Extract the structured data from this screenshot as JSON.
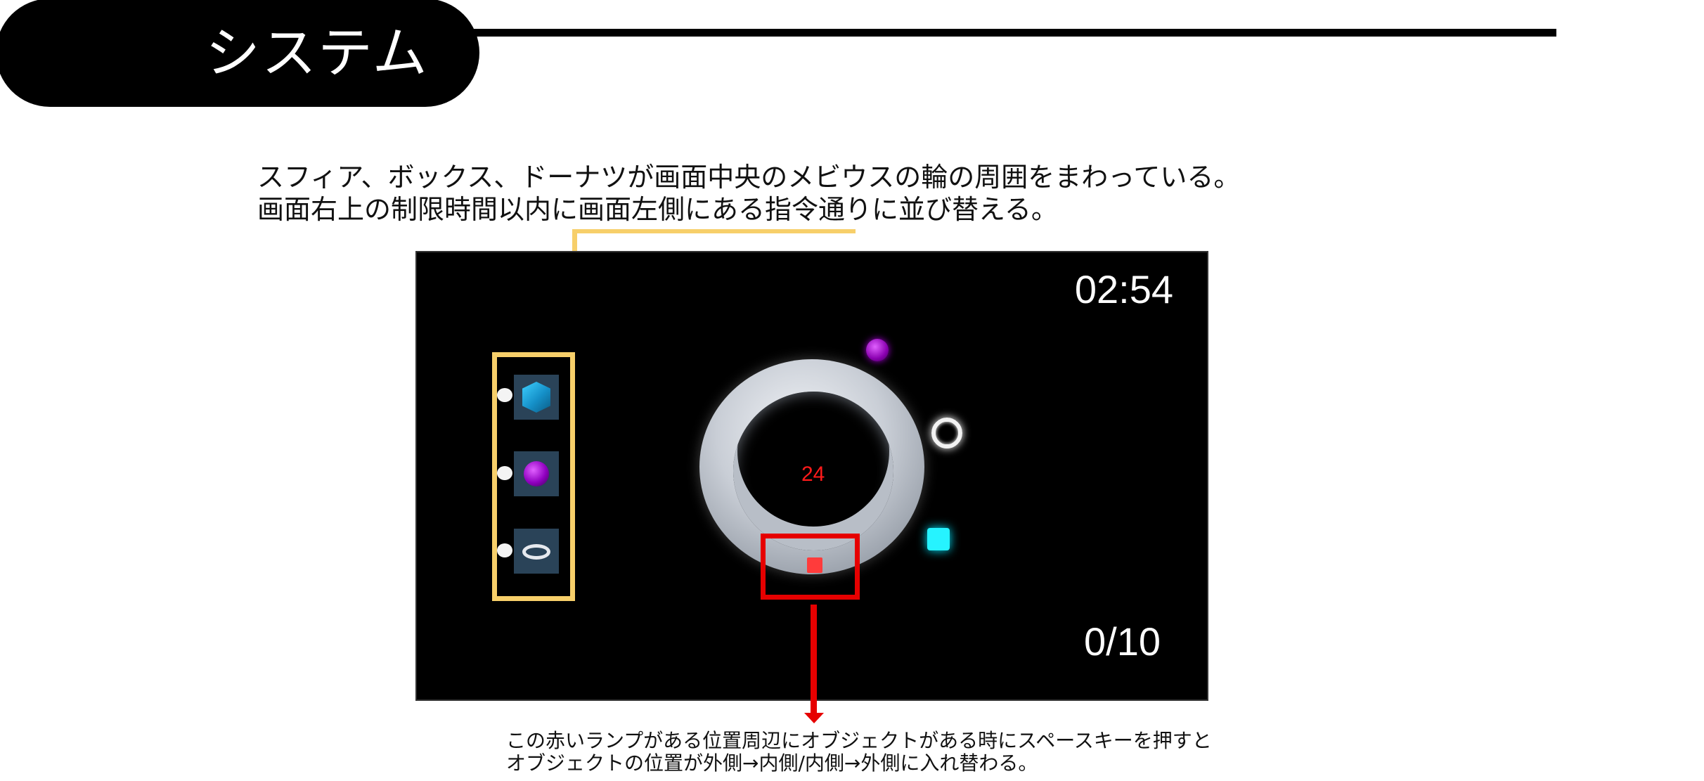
{
  "header": {
    "title": "システム"
  },
  "description": {
    "line1": "スフィア、ボックス、ドーナツが画面中央のメビウスの輪の周囲をまわっている。",
    "line2": "画面右上の制限時間以内に画面左側にある指令通りに並び替える。"
  },
  "game": {
    "timer": "02:54",
    "score": "0/10",
    "center_count": "24",
    "command_panel": {
      "items": [
        {
          "icon": "cube-icon"
        },
        {
          "icon": "sphere-icon"
        },
        {
          "icon": "torus-icon"
        }
      ]
    },
    "floating_objects": [
      {
        "icon": "purple-sphere-icon"
      },
      {
        "icon": "white-torus-icon"
      },
      {
        "icon": "cyan-box-icon"
      }
    ],
    "lamp": {
      "icon": "red-lamp-icon"
    }
  },
  "note": {
    "line1": "この赤いランプがある位置周辺にオブジェクトがある時にスペースキーを押すと",
    "line2": "オブジェクトの位置が外側→内側/内側→外側に入れ替わる。"
  },
  "colors": {
    "highlight_yellow": "#f7cf6a",
    "highlight_red": "#e60000",
    "background": "#000000"
  }
}
